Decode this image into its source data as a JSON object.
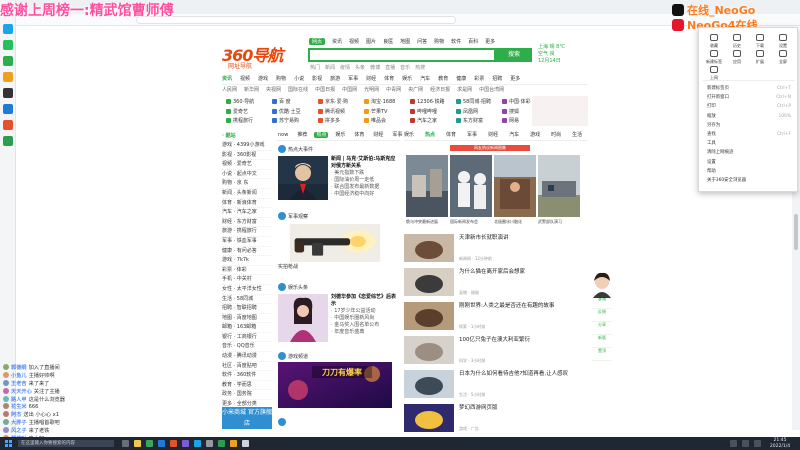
{
  "overlay": {
    "title": "感谢上周榜一:精武馆曹师傅",
    "social_douyin": "在线_NeoGo",
    "social_weibo": "NeoGo4在线"
  },
  "search": {
    "logo_text": "360导航",
    "logo_sub": "网址导航",
    "tabs": [
      "网页",
      "资讯",
      "视频",
      "图片",
      "良医",
      "地图",
      "问答",
      "购物",
      "软件",
      "百科",
      "更多"
    ],
    "active_tab": "网页",
    "button": "搜索",
    "placeholder": "",
    "hotwords": [
      "热门",
      "新闻",
      "疫情",
      "头条",
      "微博",
      "直播",
      "音乐",
      "热搜"
    ],
    "weather": [
      "上海 晴 8℃",
      "空气 良",
      "12月14日"
    ]
  },
  "nav": {
    "categories": [
      "资讯",
      "视频",
      "游戏",
      "购物",
      "小说",
      "影视",
      "旅游",
      "军事",
      "财经",
      "体育",
      "娱乐",
      "汽车",
      "教育",
      "健康",
      "彩票",
      "招聘",
      "更多"
    ],
    "sites": [
      "人民网",
      "新华网",
      "央视网",
      "国际在线",
      "中国日报",
      "中国网",
      "光明网",
      "中青网",
      "央广网",
      "经济日报",
      "求是网",
      "中国台湾网"
    ]
  },
  "famous": [
    "360·导航",
    "百 度",
    "京东·爱·购",
    "淘宝·1688",
    "12306·铁路",
    "58同城·招聘",
    "中国·体彩",
    "头条·新闻",
    "爱奇艺",
    "优酷·土豆",
    "腾讯视频",
    "芒果TV",
    "哔哩哔哩",
    "凤凰网",
    "搜狐",
    "新浪·微博",
    "携程旅行",
    "苏宁易购",
    "拼多多",
    "唯品会",
    "汽车之家",
    "东方财富",
    "网易",
    "安居客"
  ],
  "sidebar": {
    "head": "· 酷站",
    "rows": [
      "游戏 · 4399小游戏",
      "影视 · 360影视",
      "视频 · 爱奇艺",
      "小说 · 起点中文",
      "购物 · 京 东",
      "新闻 · 头条新闻",
      "体育 · 新浪体育",
      "汽车 · 汽车之家",
      "财经 · 东方财富",
      "旅游 · 携程旅行",
      "军事 · 铁血军事",
      "健康 · 有问必答",
      "游戏 · 7k7k",
      "彩票 · 体彩",
      "手机 · 中关村",
      "女性 · 太平洋女性",
      "生活 · 58同城",
      "招聘 · 智联招聘",
      "地图 · 百度地图",
      "邮箱 · 163邮箱",
      "银行 · 工商银行",
      "音乐 · QQ音乐",
      "动漫 · 腾讯动漫",
      "社区 · 百度贴吧",
      "软件 · 360软件",
      "教育 · 学而思",
      "政务 · 国务院",
      "更多 · 全部分类"
    ],
    "promo": "小米商城 官方旗舰店"
  },
  "feed": {
    "tabs": [
      "now",
      "推荐",
      "热点",
      "娱乐",
      "体育",
      "财经",
      "军事"
    ],
    "active": "热点",
    "channels": [
      {
        "name": "热点大事件",
        "headline": "新闻 | 马克·艾斯伯:马斯克应对俄方新关系",
        "lines": [
          "美元指数下跌",
          "国际油价周一走低",
          "联合国发布最新数据",
          "中国经济稳中向好"
        ]
      },
      {
        "name": "军事观察",
        "headline": "",
        "lines": []
      },
      {
        "name": "娱乐头条",
        "headline": "刘德华参加《恋爱综艺》后表示",
        "lines": [
          "17岁少年公益活动",
          "中国娱乐圈新风尚",
          "金马奖入围名单公布",
          "年度音乐盛典"
        ]
      },
      {
        "name": "游戏频道",
        "headline": "",
        "lines": []
      }
    ],
    "gun_caption": "实拍枪战",
    "game_caption": "刀刀有爆率"
  },
  "right": {
    "tabs": [
      "娱乐",
      "热点",
      "体育",
      "军事",
      "财经",
      "汽车",
      "游戏",
      "时尚",
      "生活"
    ],
    "active": "热点",
    "tagline": "网友热议新闻图集",
    "thumbs": [
      "俄乌冲突最新进展",
      "国际新闻发布会",
      "北极圈冰川融化",
      "武警部队演习"
    ],
    "news": [
      {
        "title": "天津新市长就职演讲",
        "meta": "新闻网 · 12分钟前"
      },
      {
        "title": "为什么猫在离开家后会想家",
        "meta": "宠物 · 刚刚"
      },
      {
        "title": "刚刚世界:人类之最是否还在有趣的故事",
        "meta": "探索 · 1小时前"
      },
      {
        "title": "100亿只兔子在澳大利亚繁衍",
        "meta": "科学 · 3小时前"
      },
      {
        "title": "日本为什么如何看待吉他?知道再看,让人感叹",
        "meta": "生活 · 5小时前"
      },
      {
        "title": "梦幻西游网页版",
        "meta": "游戏 · 广告"
      }
    ]
  },
  "tool_strip": [
    "客服",
    "反馈",
    "分享",
    "新版",
    "置顶"
  ],
  "menu": {
    "icons": [
      "收藏",
      "历史",
      "下载",
      "设置",
      "新建标签",
      "应用",
      "扩展",
      "全屏",
      "上网"
    ],
    "items": [
      {
        "label": "新建标签页",
        "shortcut": "Ctrl+T"
      },
      {
        "label": "打开新窗口",
        "shortcut": "Ctrl+N"
      },
      {
        "label": "打印",
        "shortcut": "Ctrl+P"
      },
      {
        "label": "缩放",
        "shortcut": "100%"
      },
      {
        "label": "另存为",
        "shortcut": ""
      },
      {
        "label": "查找",
        "shortcut": "Ctrl+F"
      },
      {
        "label": "工具",
        "shortcut": ""
      },
      {
        "label": "清除上网痕迹",
        "shortcut": ""
      },
      {
        "label": "设置",
        "shortcut": ""
      },
      {
        "label": "帮助",
        "shortcut": ""
      },
      {
        "label": "关于360安全浏览器",
        "shortcut": ""
      }
    ]
  },
  "chat": [
    {
      "name": "郭德纲",
      "text": "加入了直播间"
    },
    {
      "name": "小鱼儿",
      "text": "主播好帅啊"
    },
    {
      "name": "王老吉",
      "text": "来了来了"
    },
    {
      "name": "天天开心",
      "text": "关注了主播"
    },
    {
      "name": "路人甲",
      "text": "这是什么浏览器"
    },
    {
      "name": "花生米",
      "text": "666"
    },
    {
      "name": "阿杰",
      "text": "送出 小心心 x1"
    },
    {
      "name": "大胖子",
      "text": "主播唱首歌吧"
    },
    {
      "name": "风之子",
      "text": "来了老铁"
    },
    {
      "name": "萌萌哒",
      "text": "晚上好"
    }
  ],
  "taskbar": {
    "search_placeholder": "在这里输入你要搜索的内容",
    "time": "21:45",
    "date": "2022/1/4"
  }
}
